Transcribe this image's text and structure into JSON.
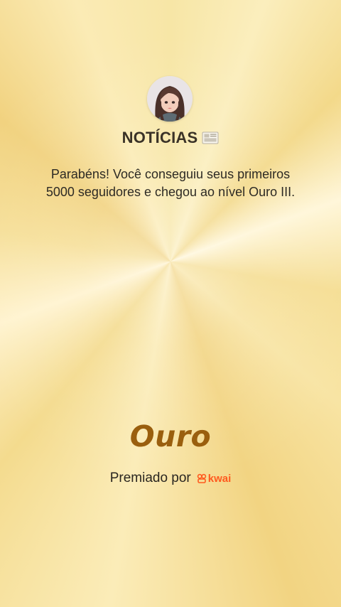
{
  "header": {
    "title": "NOTÍCIAS",
    "title_icon": "newspaper-icon"
  },
  "message": {
    "text": "Parabéns! Você conseguiu seus primeiros 5000 seguidores e chegou ao nível Ouro III."
  },
  "level": {
    "name": "Ouro"
  },
  "awarded": {
    "label": "Premiado por",
    "brand": "kwai",
    "brand_icon": "kwai-logo-icon",
    "brand_color": "#ff5a1f"
  },
  "colors": {
    "background": "#f7e6a6",
    "level_text": "#9a5f0e"
  }
}
